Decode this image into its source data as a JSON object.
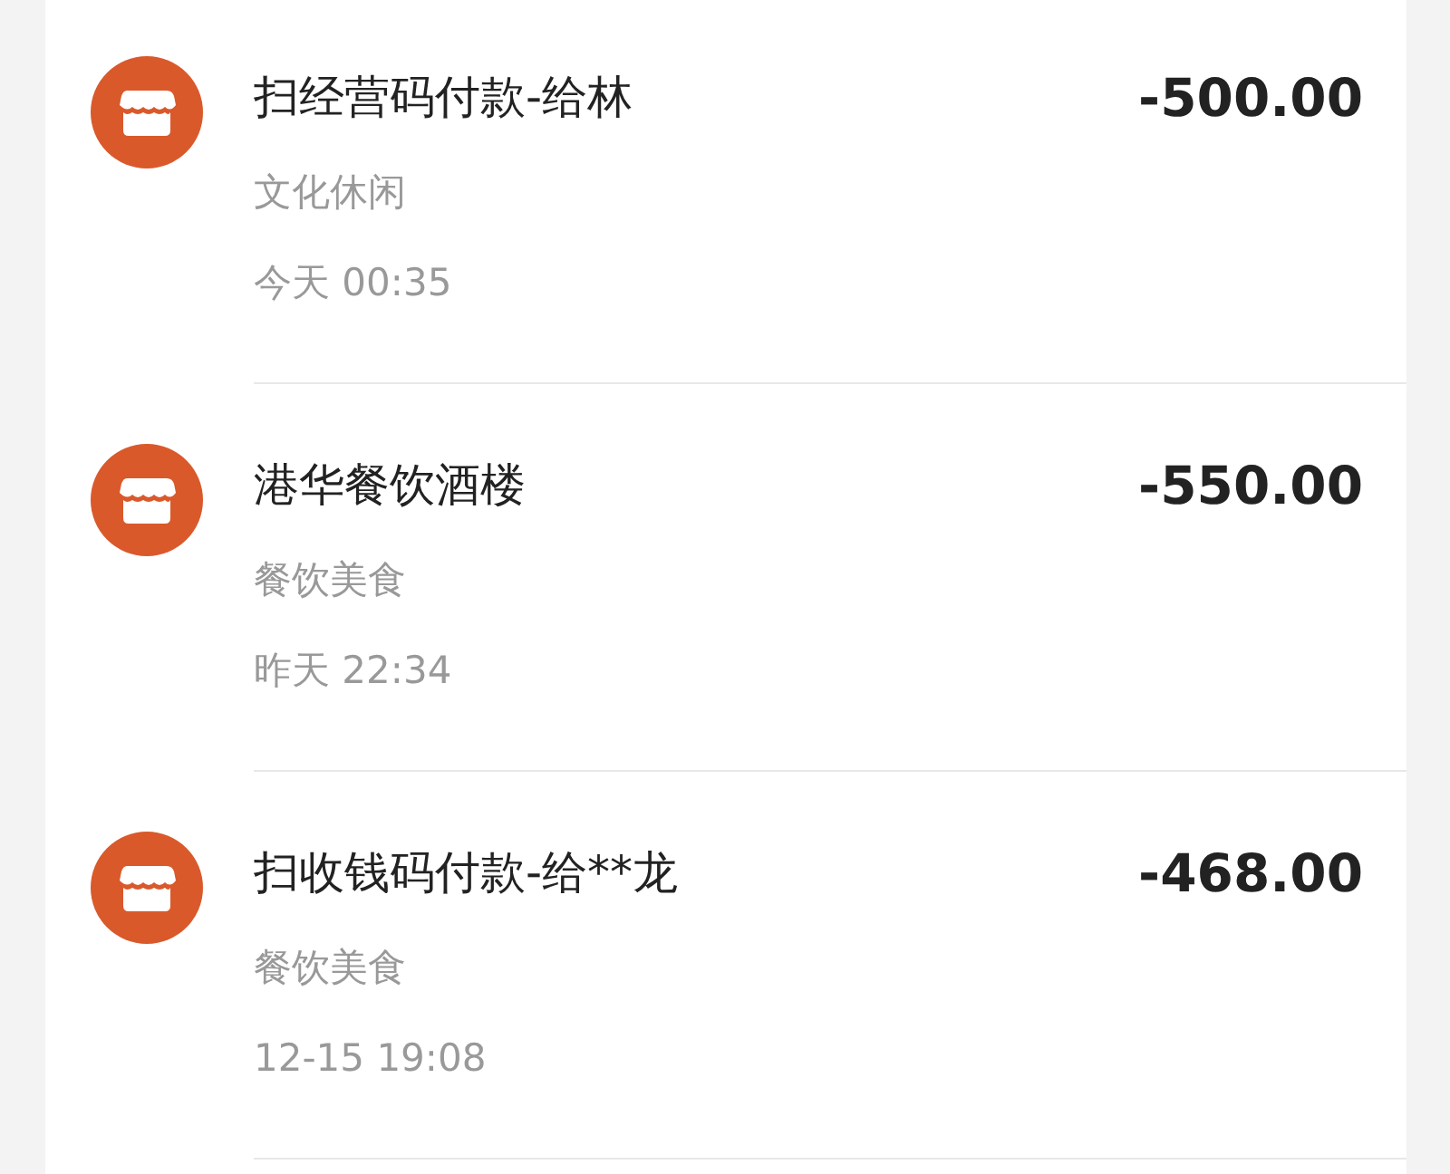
{
  "transactions": [
    {
      "title": "扫经营码付款-给林",
      "category": "文化休闲",
      "time": "今天 00:35",
      "amount": "-500.00"
    },
    {
      "title": "港华餐饮酒楼",
      "category": "餐饮美食",
      "time": "昨天 22:34",
      "amount": "-550.00"
    },
    {
      "title": "扫收钱码付款-给**龙",
      "category": "餐饮美食",
      "time": "12-15 19:08",
      "amount": "-468.00"
    }
  ]
}
